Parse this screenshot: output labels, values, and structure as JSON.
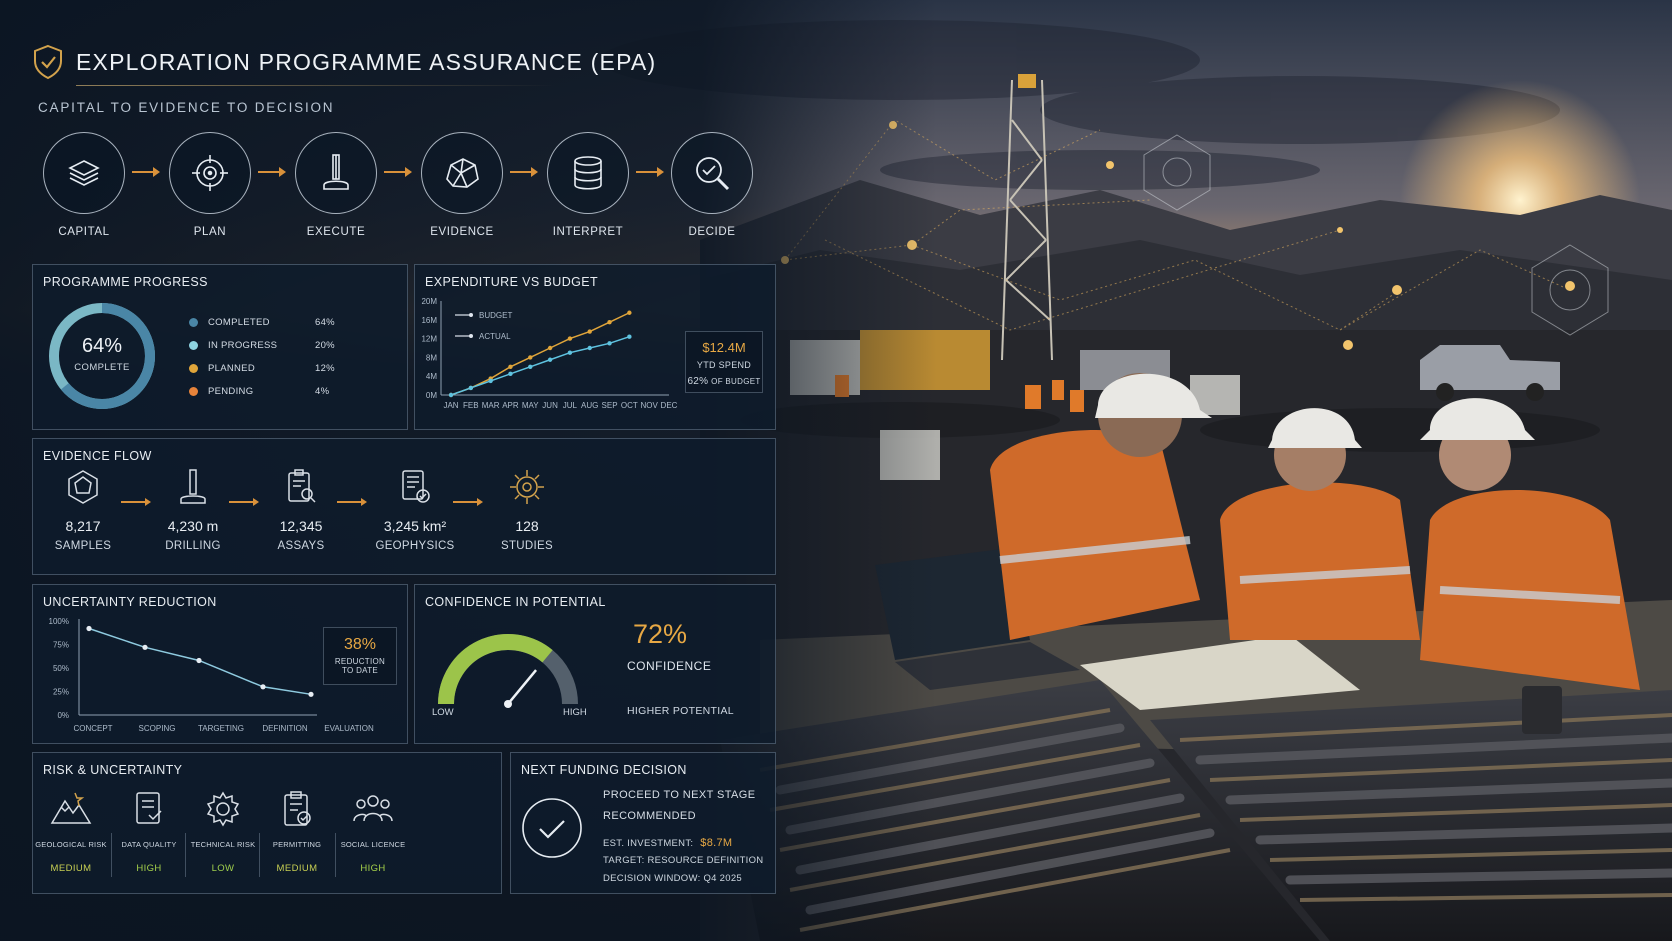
{
  "header": {
    "title": "EXPLORATION PROGRAMME ASSURANCE (EPA)",
    "subtitle": "CAPITAL TO EVIDENCE TO DECISION"
  },
  "process_steps": [
    {
      "label": "CAPITAL",
      "icon": "layers-icon"
    },
    {
      "label": "PLAN",
      "icon": "target-icon"
    },
    {
      "label": "EXECUTE",
      "icon": "drill-icon"
    },
    {
      "label": "EVIDENCE",
      "icon": "rock-icon"
    },
    {
      "label": "INTERPRET",
      "icon": "database-icon"
    },
    {
      "label": "DECIDE",
      "icon": "search-check-icon"
    }
  ],
  "programme_progress": {
    "title": "PROGRAMME PROGRESS",
    "center_value": "64%",
    "center_label": "COMPLETE",
    "completed_fraction": 0.64,
    "legend": [
      {
        "label": "COMPLETED",
        "value": "64%",
        "color": "#4a86a6"
      },
      {
        "label": "IN PROGRESS",
        "value": "20%",
        "color": "#8ed3e0"
      },
      {
        "label": "PLANNED",
        "value": "12%",
        "color": "#e0a53a"
      },
      {
        "label": "PENDING",
        "value": "4%",
        "color": "#e7833a"
      }
    ]
  },
  "expenditure": {
    "title": "EXPENDITURE VS BUDGET",
    "ytd_value": "$12.4M",
    "ytd_label": "YTD SPEND",
    "budget_pct": "62%",
    "budget_pct_label": "OF BUDGET"
  },
  "evidence_flow": {
    "title": "EVIDENCE FLOW",
    "items": [
      {
        "value": "8,217",
        "label": "SAMPLES",
        "icon": "sample-icon"
      },
      {
        "value": "4,230 m",
        "label": "DRILLING",
        "icon": "drill-icon"
      },
      {
        "value": "12,345",
        "label": "ASSAYS",
        "icon": "assay-clipboard-icon"
      },
      {
        "value": "3,245 km²",
        "label": "GEOPHYSICS",
        "icon": "geophysics-report-icon"
      },
      {
        "value": "128",
        "label": "STUDIES",
        "icon": "studies-target-icon"
      }
    ]
  },
  "uncertainty": {
    "title": "UNCERTAINTY REDUCTION",
    "callout_value": "38%",
    "callout_label_1": "REDUCTION",
    "callout_label_2": "TO DATE"
  },
  "confidence": {
    "title": "CONFIDENCE IN POTENTIAL",
    "value": "72%",
    "label": "CONFIDENCE",
    "low": "LOW",
    "high": "HIGH",
    "note": "HIGHER POTENTIAL",
    "level_fraction": 0.72
  },
  "risk": {
    "title": "RISK & UNCERTAINTY",
    "items": [
      {
        "label": "GEOLOGICAL RISK",
        "value": "MEDIUM",
        "color": "#c7cf52",
        "icon": "mountain-icon"
      },
      {
        "label": "DATA QUALITY",
        "value": "HIGH",
        "color": "#a6d24a",
        "icon": "checklist-icon"
      },
      {
        "label": "TECHNICAL RISK",
        "value": "LOW",
        "color": "#9fcf4d",
        "icon": "gear-icon"
      },
      {
        "label": "PERMITTING",
        "value": "MEDIUM",
        "color": "#c7cf52",
        "icon": "permit-clipboard-icon"
      },
      {
        "label": "SOCIAL LICENCE",
        "value": "HIGH",
        "color": "#a6d24a",
        "icon": "people-icon"
      }
    ]
  },
  "next_funding": {
    "title": "NEXT FUNDING DECISION",
    "line1": "PROCEED TO NEXT STAGE",
    "line2": "RECOMMENDED",
    "investment_label": "EST. INVESTMENT:",
    "investment_value": "$8.7M",
    "target": "TARGET: RESOURCE DEFINITION",
    "window": "DECISION WINDOW: Q4 2025"
  },
  "colors": {
    "accent_orange": "#d9913a",
    "budget_line": "#e0a53a",
    "actual_line": "#5fc3e0",
    "panel_border": "#5a6b7e"
  },
  "chart_data": [
    {
      "type": "line",
      "title": "EXPENDITURE VS BUDGET",
      "categories": [
        "JAN",
        "FEB",
        "MAR",
        "APR",
        "MAY",
        "JUN",
        "JUL",
        "AUG",
        "SEP",
        "OCT",
        "NOV",
        "DEC"
      ],
      "y_ticks": [
        "0M",
        "4M",
        "8M",
        "12M",
        "16M",
        "20M"
      ],
      "ylim": [
        0,
        20
      ],
      "series": [
        {
          "name": "BUDGET",
          "values": [
            0,
            1.5,
            3.5,
            6,
            8,
            10,
            12,
            13.5,
            15.5,
            17.5,
            null,
            null
          ]
        },
        {
          "name": "ACTUAL",
          "values": [
            0,
            1.5,
            3,
            4.5,
            6,
            7.5,
            9,
            10,
            11,
            12.4,
            null,
            null
          ]
        }
      ]
    },
    {
      "type": "line",
      "title": "UNCERTAINTY REDUCTION",
      "categories": [
        "CONCEPT",
        "SCOPING",
        "TARGETING",
        "DEFINITION",
        "EVALUATION"
      ],
      "y_ticks": [
        "0%",
        "25%",
        "50%",
        "75%",
        "100%"
      ],
      "ylim": [
        0,
        100
      ],
      "series": [
        {
          "values": [
            92,
            72,
            58,
            30,
            22
          ]
        }
      ]
    }
  ]
}
